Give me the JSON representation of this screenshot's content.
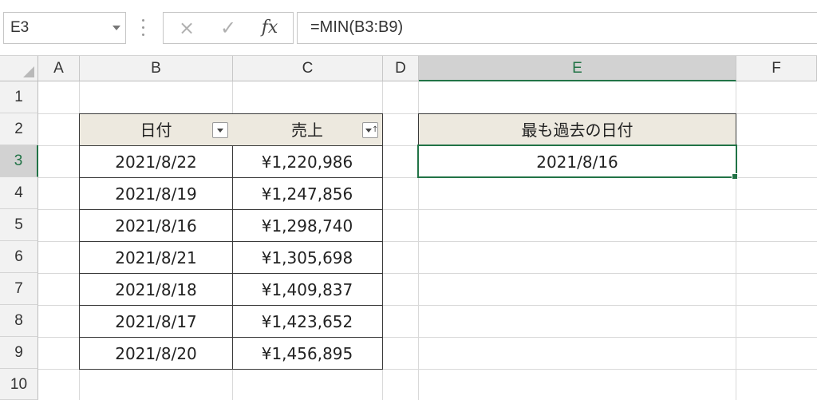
{
  "formula_bar": {
    "name_box": "E3",
    "cancel_icon": "×",
    "enter_icon": "✓",
    "fx_label": "fx",
    "formula": "=MIN(B3:B9)"
  },
  "grid": {
    "columns": [
      "A",
      "B",
      "C",
      "D",
      "E",
      "F"
    ],
    "rows": [
      "1",
      "2",
      "3",
      "4",
      "5",
      "6",
      "7",
      "8",
      "9",
      "10"
    ],
    "active_cell": "E3",
    "active_column": "E",
    "active_row": "3"
  },
  "table": {
    "headers": [
      "日付",
      "売上"
    ],
    "rows": [
      [
        "2021/8/22",
        "¥1,220,986"
      ],
      [
        "2021/8/19",
        "¥1,247,856"
      ],
      [
        "2021/8/16",
        "¥1,298,740"
      ],
      [
        "2021/8/21",
        "¥1,305,698"
      ],
      [
        "2021/8/18",
        "¥1,409,837"
      ],
      [
        "2021/8/17",
        "¥1,423,652"
      ],
      [
        "2021/8/20",
        "¥1,456,895"
      ]
    ],
    "filter_sort_icon": "↑"
  },
  "result": {
    "label": "最も過去の日付",
    "value": "2021/8/16"
  },
  "colors": {
    "accent": "#217346",
    "header_fill": "#ede9df",
    "table_border": "#3a3a3a"
  }
}
